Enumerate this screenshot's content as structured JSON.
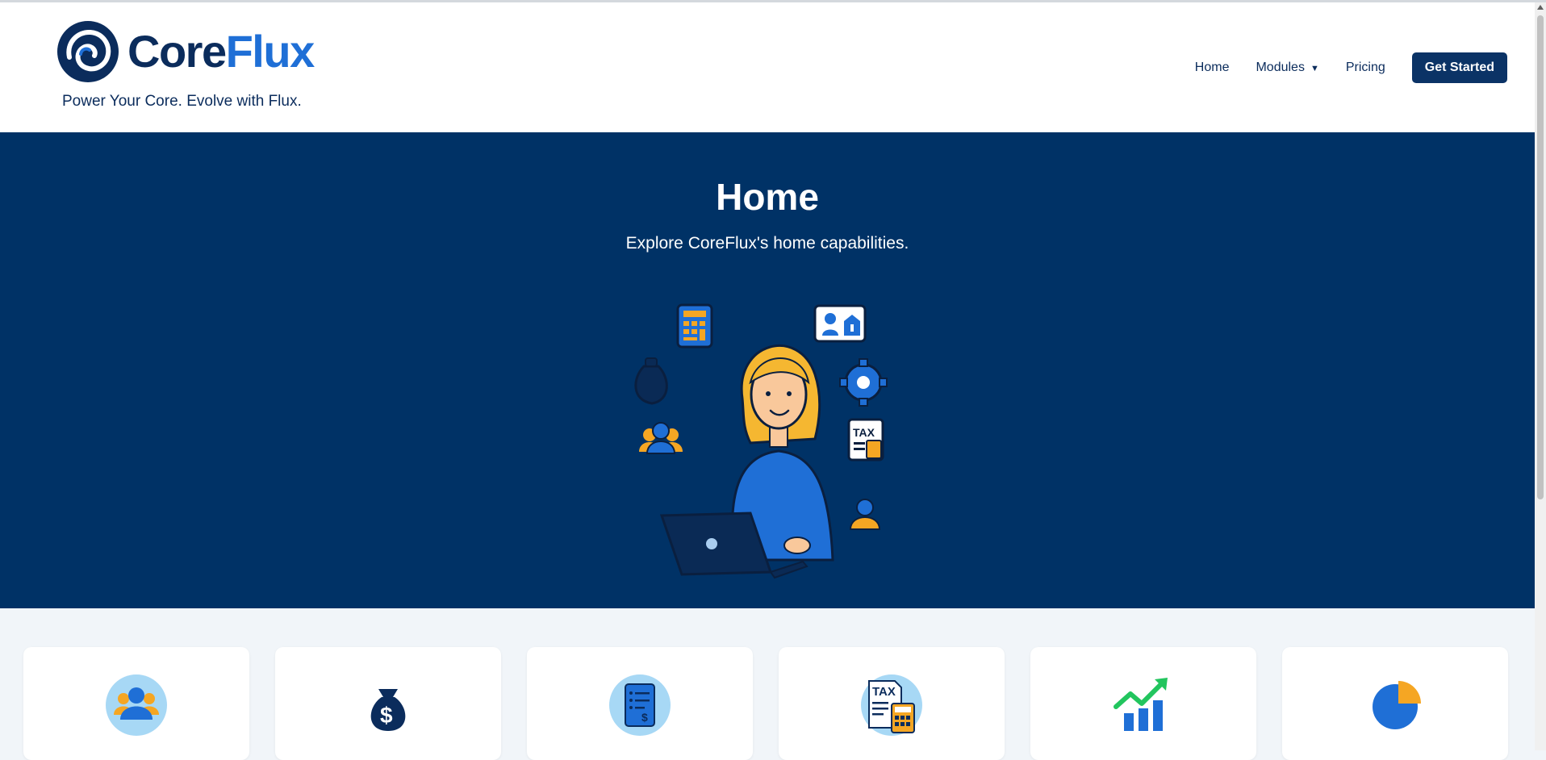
{
  "brand": {
    "name_part1": "Core",
    "name_part2": "Flux",
    "tagline": "Power Your Core. Evolve with Flux.",
    "colors": {
      "primary": "#0b2c5c",
      "accent": "#1f6fd6",
      "hero": "#003266"
    }
  },
  "nav": {
    "items": [
      {
        "label": "Home"
      },
      {
        "label": "Modules",
        "caret": "▼"
      },
      {
        "label": "Pricing"
      }
    ],
    "cta_label": "Get Started"
  },
  "hero": {
    "title": "Home",
    "subtitle": "Explore CoreFlux's home capabilities.",
    "illustration_icon": "woman-with-laptop-illustration"
  },
  "cards": [
    {
      "icon": "team-icon"
    },
    {
      "icon": "money-bag-icon"
    },
    {
      "icon": "payroll-document-icon"
    },
    {
      "icon": "tax-calculator-icon"
    },
    {
      "icon": "growth-chart-icon"
    },
    {
      "icon": "pie-chart-icon"
    }
  ]
}
